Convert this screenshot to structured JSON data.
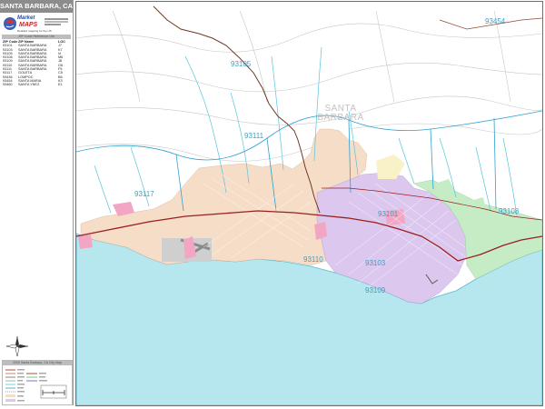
{
  "map": {
    "title": "SANTA BARBARA, CA",
    "city_label_line1": "SANTA",
    "city_label_line2": "BARBARA",
    "zip_labels": {
      "z93454": "93454",
      "z93105": "93105",
      "z93111": "93111",
      "z93117": "93117",
      "z93110": "93110",
      "z93101": "93101",
      "z93108": "93108",
      "z93103": "93103",
      "z93109": "93109"
    },
    "colors": {
      "ocean": "#b6e6ee",
      "goleta_area": "#f6ddc8",
      "sb_downtown": "#dcc8ee",
      "montecito": "#c6ecc6",
      "pink_area": "#f3a6c3",
      "water_line": "#56c4dc",
      "highway": "#9a1f1f",
      "zip_boundary": "#2f9fd0"
    }
  },
  "sidebar": {
    "logo_line1": "Market",
    "logo_line2": "MAPS",
    "logo_sub": "Detailed mapping for the US",
    "zip_header": "ZIP Code Reference List",
    "table_headers": {
      "zip": "ZIP Code",
      "name": "ZIP Name",
      "loc": "LOC"
    },
    "zip_rows": [
      {
        "zip": "93101",
        "name": "SANTA BARBARA",
        "loc": "J7"
      },
      {
        "zip": "93103",
        "name": "SANTA BARBARA",
        "loc": "K7"
      },
      {
        "zip": "93105",
        "name": "SANTA BARBARA",
        "loc": "I4"
      },
      {
        "zip": "93108",
        "name": "SANTA BARBARA",
        "loc": "M6"
      },
      {
        "zip": "93109",
        "name": "SANTA BARBARA",
        "loc": "J8"
      },
      {
        "zip": "93110",
        "name": "SANTA BARBARA",
        "loc": "G6"
      },
      {
        "zip": "93111",
        "name": "SANTA BARBARA",
        "loc": "F5"
      },
      {
        "zip": "93117",
        "name": "GOLETA",
        "loc": "C5"
      },
      {
        "zip": "93436",
        "name": "LOMPOC",
        "loc": "B6"
      },
      {
        "zip": "93454",
        "name": "SANTA MARIA",
        "loc": "K3"
      },
      {
        "zip": "93460",
        "name": "SANTA YNEZ",
        "loc": "E1"
      }
    ],
    "legend_title": "2009 Santa Barbara, CA City Map"
  }
}
